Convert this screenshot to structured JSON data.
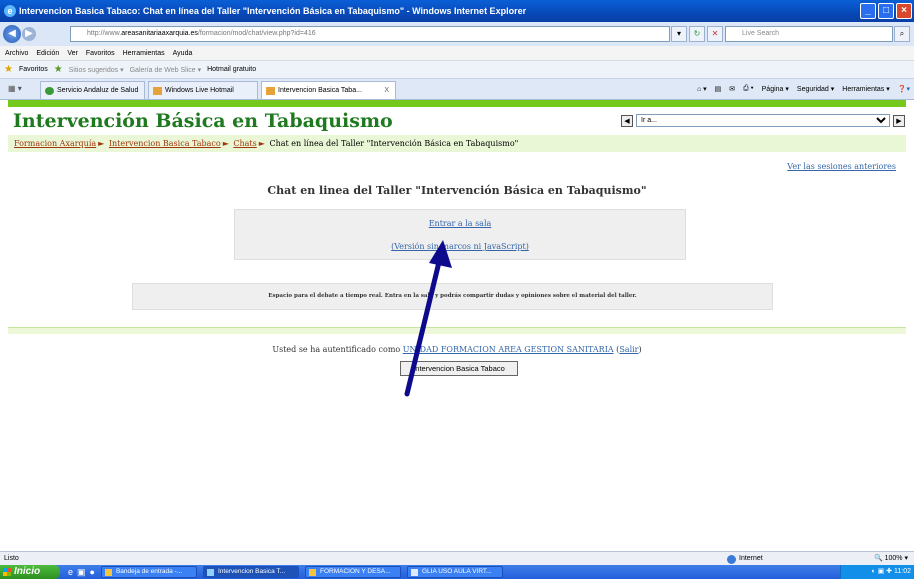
{
  "window": {
    "title": "Intervencion Basica Tabaco: Chat en línea del Taller \"Intervención Básica en Tabaquismo\" - Windows Internet Explorer"
  },
  "addressbar": {
    "url_prefix": "http://www.",
    "url_domain": "areasanitariaaxarquia.es",
    "url_path": "/formacion/mod/chat/view.php?id=416",
    "search_placeholder": "Live Search"
  },
  "menu": [
    "Archivo",
    "Edición",
    "Ver",
    "Favoritos",
    "Herramientas",
    "Ayuda"
  ],
  "favorites": {
    "label": "Favoritos",
    "items": [
      "Sitios sugeridos ▾",
      "Galería de Web Slice ▾",
      "Hotmail gratuito"
    ]
  },
  "tabs": [
    {
      "label": "Servicio Andaluz de Salud"
    },
    {
      "label": "Windows Live Hotmail"
    },
    {
      "label": "Intervencion Basica Taba...",
      "close": "X"
    }
  ],
  "command_bar": [
    "Página ▾",
    "Seguridad ▾",
    "Herramientas ▾"
  ],
  "page": {
    "site_title": "Intervención Básica en Tabaquismo",
    "jump_placeholder": "Ir a...",
    "breadcrumb": {
      "items": [
        "Formacion Axarquía",
        "Intervencion Basica Tabaco",
        "Chats"
      ],
      "current": "Chat en línea del Taller \"Intervención Básica en Tabaquismo\""
    },
    "prev_sessions": "Ver las sesiones anteriores",
    "heading": "Chat en linea del Taller \"Intervención Básica en Tabaquismo\"",
    "enter_room": "Entrar a la sala",
    "no_js_version": "(Versión sin marcos ni JavaScript)",
    "description": "Espacio para el debate a tiempo real. Entra en la sala y podrás compartir dudas y opiniones sobre el material del taller.",
    "login_prefix": "Usted se ha autentificado como",
    "login_user": "UNIDAD FORMACION AREA GESTION SANITARIA",
    "logout": "Salir",
    "home_button": "Intervencion Basica Tabaco"
  },
  "status": {
    "text": "Listo",
    "zone": "Internet",
    "zoom": "100%"
  },
  "taskbar": {
    "start": "Inicio",
    "items": [
      "Bandeja de entrada -...",
      "Intervencion Basica T...",
      "FORMACION Y DESA...",
      "GLIA USO AULA VIRT..."
    ],
    "clock": "11:02"
  },
  "colors": {
    "accent_green": "#74c91c",
    "title_green": "#1f7a1f",
    "arrow": "#0d0b8c"
  }
}
